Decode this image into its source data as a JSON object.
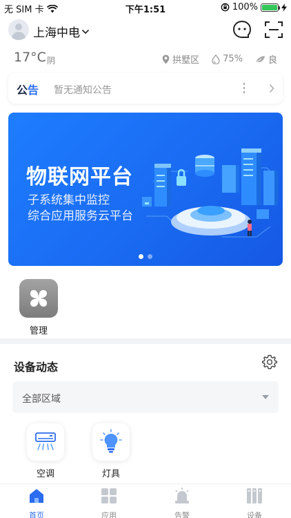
{
  "status_bar": {
    "carrier": "无 SIM 卡",
    "time": "下午1:51",
    "battery_percent": "100%",
    "battery_level": 1.0
  },
  "header": {
    "city": "上海中电"
  },
  "weather": {
    "temperature": "17°C",
    "condition": "阴",
    "district": "拱墅区",
    "humidity": "75%",
    "air_quality": "良"
  },
  "notice": {
    "tag_part1": "公",
    "tag_part2": "告",
    "text": "暂无通知公告"
  },
  "banner": {
    "title": "物联网平台",
    "subtitle_line1": "子系统集中监控",
    "subtitle_line2": "综合应用服务云平台",
    "page_count": 2,
    "current_page": 1
  },
  "apps": {
    "manage_label": "管理"
  },
  "device_section": {
    "title": "设备动态",
    "region_value": "全部区域",
    "devices": [
      {
        "label": "空调",
        "icon": "air-conditioner-icon"
      },
      {
        "label": "灯具",
        "icon": "light-bulb-icon"
      }
    ]
  },
  "tabbar": {
    "tabs": [
      {
        "label": "首页",
        "icon": "home-icon",
        "active": true
      },
      {
        "label": "应用",
        "icon": "apps-grid-icon",
        "active": false
      },
      {
        "label": "告警",
        "icon": "alarm-icon",
        "active": false
      },
      {
        "label": "设备",
        "icon": "device-icon",
        "active": false
      }
    ]
  },
  "colors": {
    "accent": "#2b6cf0",
    "banner_blue": "#1a6bf2",
    "battery_green": "#34c759"
  }
}
